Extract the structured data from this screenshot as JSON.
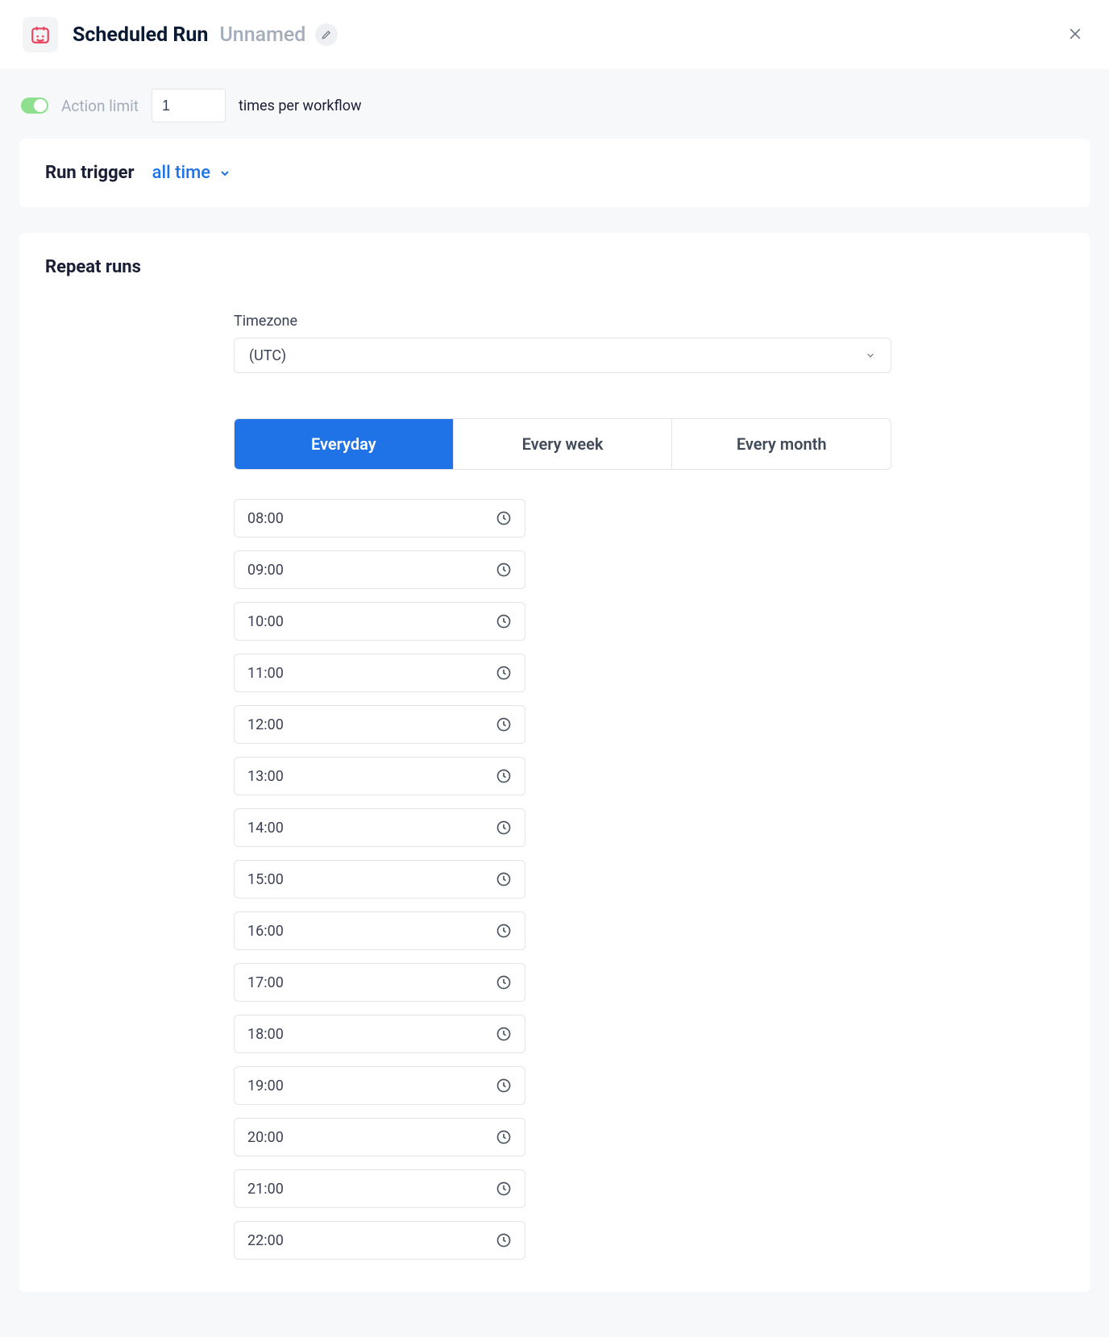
{
  "header": {
    "title": "Scheduled Run",
    "subtitle": "Unnamed"
  },
  "action_limit": {
    "enabled": true,
    "label": "Action limit",
    "value": "1",
    "suffix": "times per workflow"
  },
  "run_trigger": {
    "label": "Run trigger",
    "value": "all time"
  },
  "repeat": {
    "label": "Repeat runs",
    "timezone_label": "Timezone",
    "timezone_value": "(UTC)",
    "tabs": [
      {
        "label": "Everyday",
        "active": true
      },
      {
        "label": "Every week",
        "active": false
      },
      {
        "label": "Every month",
        "active": false
      }
    ],
    "times": [
      "08:00",
      "09:00",
      "10:00",
      "11:00",
      "12:00",
      "13:00",
      "14:00",
      "15:00",
      "16:00",
      "17:00",
      "18:00",
      "19:00",
      "20:00",
      "21:00",
      "22:00"
    ]
  },
  "colors": {
    "accent": "#1f73e6",
    "danger": "#e64560",
    "toggle_on": "#8ee08e"
  }
}
